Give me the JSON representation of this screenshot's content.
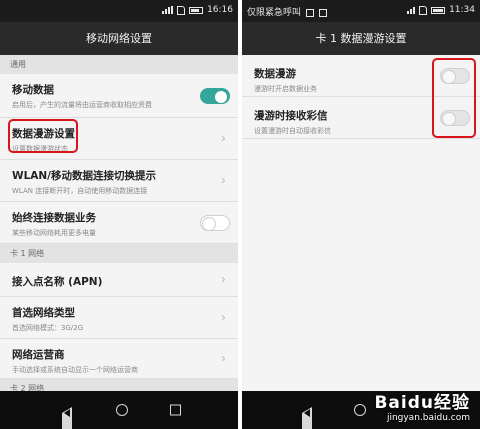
{
  "left": {
    "status": {
      "time": "16:16"
    },
    "title": "移动网络设置",
    "sections": {
      "general": "通用",
      "card1": "卡 1 网络",
      "card2": "卡 2 网络"
    },
    "rows": {
      "mobile_data": {
        "title": "移动数据",
        "sub": "启用后，产生的流量将由运营商收取相应资费",
        "toggle": "on"
      },
      "roaming_settings": {
        "title": "数据漫游设置",
        "sub": "设置数据漫游状态"
      },
      "wlan_switch": {
        "title": "WLAN/移动数据连接切换提示",
        "sub": "WLAN 连接断开时，自动使用移动数据连接"
      },
      "always_on": {
        "title": "始终连接数据业务",
        "sub": "某些移动网络耗用更多电量",
        "toggle": "off"
      },
      "apn": {
        "title": "接入点名称 (APN)"
      },
      "preferred_network": {
        "title": "首选网络类型",
        "sub": "首选网络模式：3G/2G"
      },
      "operator": {
        "title": "网络运营商",
        "sub": "手动选择或系统自动显示一个网络运营商"
      }
    }
  },
  "right": {
    "status": {
      "left_text": "仅限紧急呼叫",
      "time": "11:34"
    },
    "title": "卡 1 数据漫游设置",
    "rows": {
      "data_roaming": {
        "title": "数据漫游",
        "sub": "漫游时开启数据业务",
        "toggle": "off"
      },
      "mms_roaming": {
        "title": "漫游时接收彩信",
        "sub": "设置漫游时自动接收彩信",
        "toggle": "off"
      }
    }
  },
  "watermark": {
    "logo": "Baidu经验",
    "url": "jingyan.baidu.com"
  },
  "colors": {
    "accent_toggle": "#36a69a",
    "highlight": "#d8141c",
    "titlebar": "#2a2a2a",
    "statusbar": "#1c1c1c"
  },
  "icons": [
    "signal-icon",
    "sim-icon",
    "battery-icon",
    "chevron-right-icon",
    "back-icon",
    "home-icon",
    "recent-apps-icon"
  ]
}
